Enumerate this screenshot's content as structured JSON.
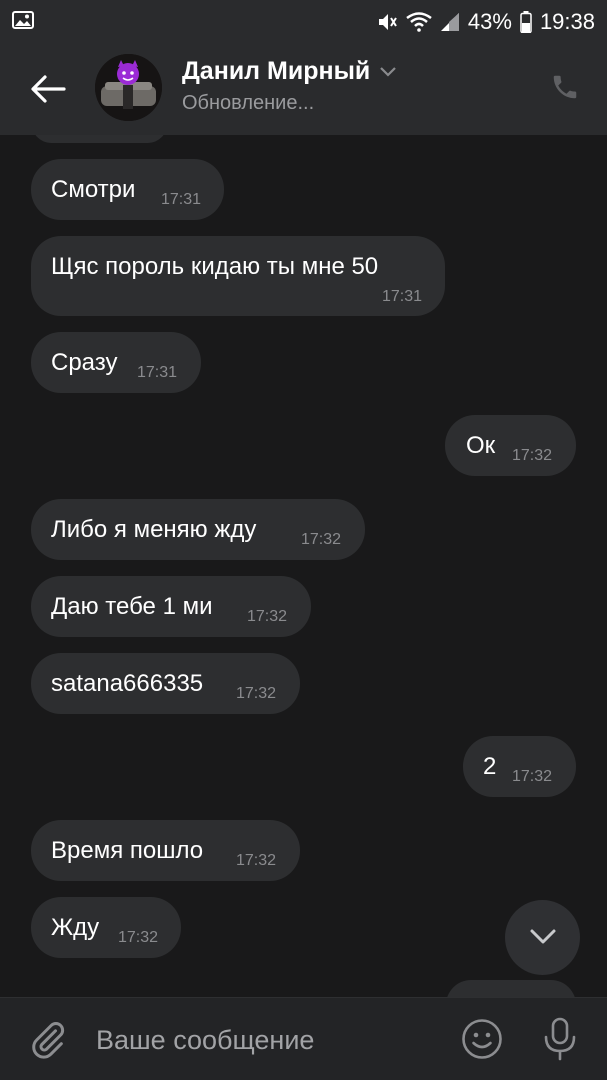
{
  "status_bar": {
    "battery_percent": "43%",
    "time": "19:38",
    "icons": [
      "gallery-icon",
      "mute-icon",
      "wifi-icon",
      "signal-icon",
      "battery-icon"
    ]
  },
  "header": {
    "contact_name": "Данил Мирный",
    "contact_status": "Обновление...",
    "icons": [
      "back-arrow-icon",
      "chevron-down-icon",
      "phone-icon"
    ]
  },
  "messages": [
    {
      "side": "in",
      "text": "Смотри",
      "time": "17:31"
    },
    {
      "side": "in",
      "text": "Щяс пороль кидаю ты мне 50",
      "time": "17:31"
    },
    {
      "side": "in",
      "text": "Сразу",
      "time": "17:31"
    },
    {
      "side": "out",
      "text": "Ок",
      "time": "17:32"
    },
    {
      "side": "in",
      "text": "Либо я меняю жду",
      "time": "17:32"
    },
    {
      "side": "in",
      "text": "Даю тебе 1 ми",
      "time": "17:32"
    },
    {
      "side": "in",
      "text": "satana666335",
      "time": "17:32"
    },
    {
      "side": "out",
      "text": "2",
      "time": "17:32"
    },
    {
      "side": "in",
      "text": "Время пошло",
      "time": "17:32"
    },
    {
      "side": "in",
      "text": "Жду",
      "time": "17:32"
    }
  ],
  "composer": {
    "placeholder": "Ваше сообщение",
    "icons": [
      "paperclip-icon",
      "emoji-icon",
      "microphone-icon"
    ]
  },
  "colors": {
    "background": "#19191a",
    "bar": "#2a2b2d",
    "bubble": "#2d2e30",
    "secondary_text": "#9a9b9e"
  }
}
